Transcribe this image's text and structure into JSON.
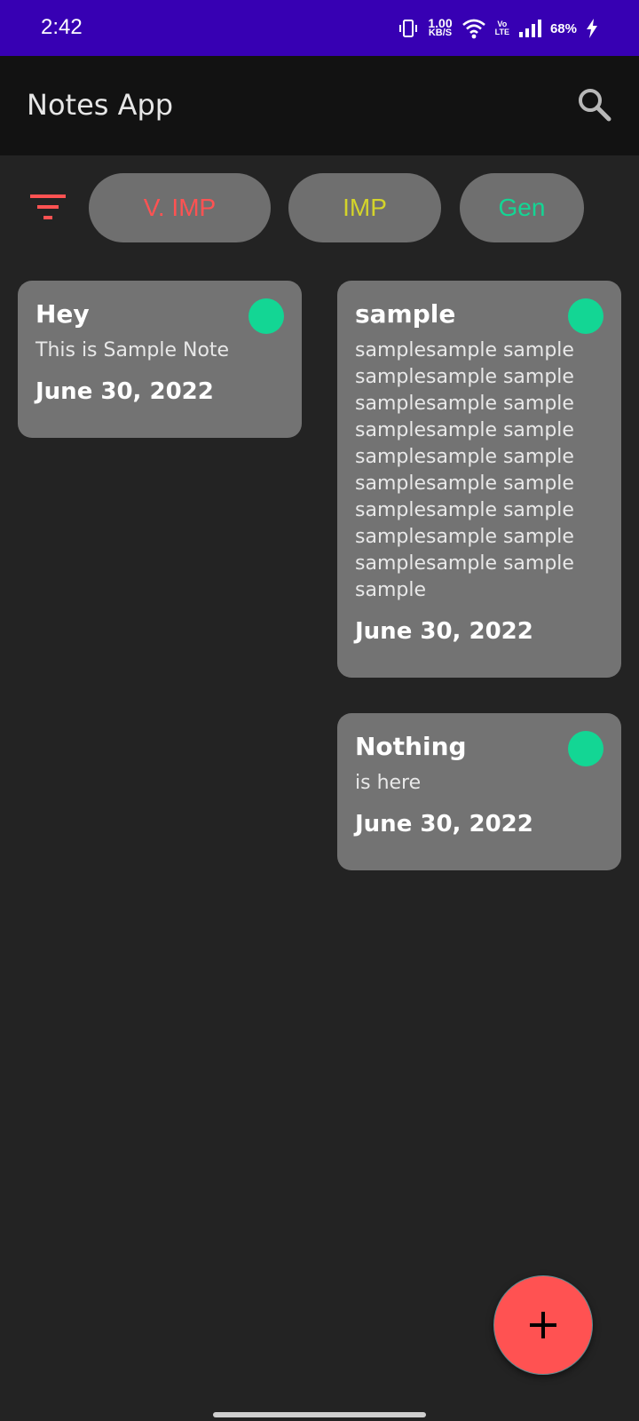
{
  "status_bar": {
    "time": "2:42",
    "speed_value": "1.00",
    "speed_unit": "KB/S",
    "volte_top": "Vo",
    "volte_bottom": "LTE",
    "battery": "68%",
    "icons": [
      "vibrate-icon",
      "wifi-icon",
      "signal-icon",
      "charging-bolt-icon"
    ]
  },
  "app_bar": {
    "title": "Notes App",
    "search_icon": "search-icon"
  },
  "filters": {
    "filter_icon": "filter-icon",
    "filter_icon_color": "#ff5252",
    "chips": [
      {
        "label": "V. IMP",
        "color": "#ff5252"
      },
      {
        "label": "IMP",
        "color": "#d4d42a"
      },
      {
        "label": "Gen",
        "color": "#13d694"
      }
    ]
  },
  "notes": [
    {
      "title": "Hey",
      "body": "This is Sample Note",
      "date": "June 30, 2022",
      "priority_color": "#13d694"
    },
    {
      "title": "sample",
      "body": "samplesample sample samplesample sample samplesample sample samplesample sample samplesample sample samplesample sample samplesample sample samplesample sample samplesample sample sample",
      "date": "June 30, 2022",
      "priority_color": "#13d694"
    },
    {
      "title": "Nothing",
      "body": "is here",
      "date": "June 30, 2022",
      "priority_color": "#13d694"
    }
  ],
  "fab": {
    "label": "+",
    "icon": "add-icon",
    "color": "#ff5252"
  }
}
